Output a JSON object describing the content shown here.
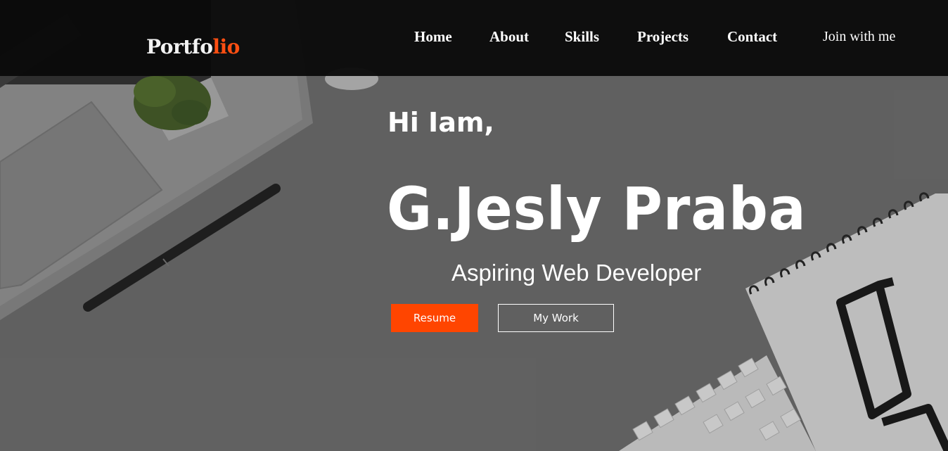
{
  "header": {
    "logo_main": "Portfo",
    "logo_accent": "lio",
    "nav": [
      {
        "label": "Home"
      },
      {
        "label": "About"
      },
      {
        "label": "Skills"
      },
      {
        "label": "Projects"
      },
      {
        "label": "Contact"
      }
    ],
    "join_label": "Join with me"
  },
  "hero": {
    "greeting": "Hi Iam,",
    "name": "G.Jesly Praba",
    "role": "Aspiring Web Developer",
    "resume_label": "Resume",
    "work_label": "My Work"
  },
  "colors": {
    "accent": "#ff4500",
    "nav_background": "#0a0a0a",
    "hero_background": "#6e6e6e"
  }
}
